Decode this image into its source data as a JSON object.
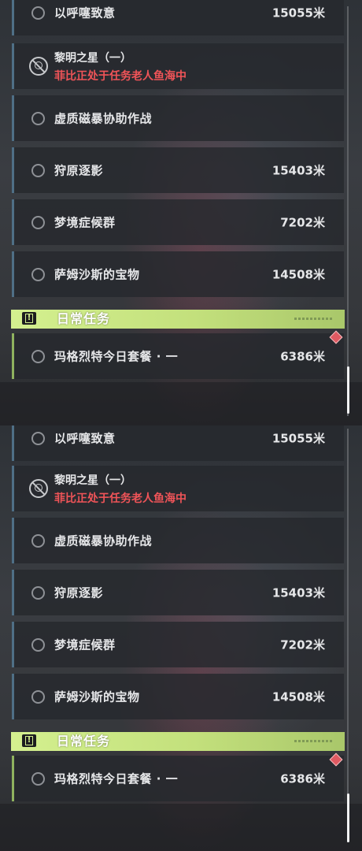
{
  "quests": [
    {
      "title": "以呼噻致意",
      "distance": "15055米"
    },
    {
      "title": "黎明之星（一）",
      "status": "菲比正处于任务老人鱼海中"
    },
    {
      "title": "虚质磁暴协助作战",
      "distance": ""
    },
    {
      "title": "狩原逐影",
      "distance": "15403米"
    },
    {
      "title": "梦境症候群",
      "distance": "7202米"
    },
    {
      "title": "萨姆沙斯的宝物",
      "distance": "14508米"
    }
  ],
  "daily_section": {
    "title": "日常任务",
    "icon": "exclamation-icon",
    "items": [
      {
        "title": "玛格烈特今日套餐 · 一",
        "distance": "6386米"
      }
    ]
  },
  "colors": {
    "accent_green": "#c3e07c",
    "alert_red": "#f05458",
    "quest_border_blue": "#4f6f86"
  }
}
